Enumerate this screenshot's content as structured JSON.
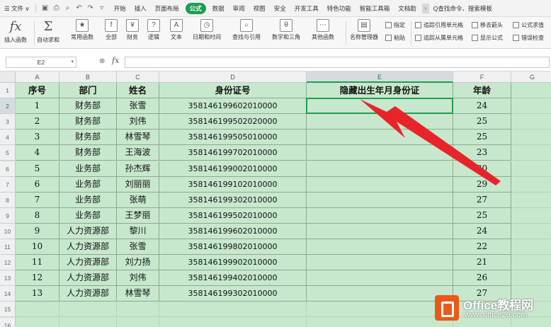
{
  "menubar": {
    "file_label": "☰ 文件 ∨",
    "tabs": [
      "开始",
      "插入",
      "页面布局",
      "公式",
      "数据",
      "审阅",
      "视图",
      "安全",
      "开发工具",
      "特色功能",
      "智能工具箱",
      "文档助"
    ],
    "active_tab": "公式",
    "search_label": "Q查找命令、搜索模板"
  },
  "ribbon": {
    "insert_function": "插入函数",
    "autosum": "自动求和",
    "common_functions": "常用函数",
    "all": "全部",
    "finance": "财务",
    "logic": "逻辑",
    "text": "文本",
    "datetime": "日期和时间",
    "lookup": "查找与引用",
    "math": "数学和三角",
    "other_functions": "其他函数",
    "name_manager": "名称管理器",
    "specify": "指定",
    "paste": "粘贴",
    "trace_precedents": "追踪引用单元格",
    "trace_dependents": "追踪从属单元格",
    "remove_arrows": "移去箭头",
    "show_formulas": "显示公式",
    "evaluate": "公式求值",
    "error_check": "错误检查"
  },
  "formula_bar": {
    "cell_ref": "E2",
    "fx_label": "fx",
    "formula": ""
  },
  "sheet": {
    "columns": [
      "A",
      "B",
      "C",
      "D",
      "E",
      "F",
      "G"
    ],
    "selected_column": "E",
    "row_numbers": [
      "1",
      "2",
      "3",
      "4",
      "5",
      "6",
      "7",
      "8",
      "9",
      "10",
      "11",
      "12",
      "13",
      "14",
      "15",
      "16"
    ],
    "selected_row": "2",
    "headers": [
      "序号",
      "部门",
      "姓名",
      "身份证号",
      "隐藏出生年月身份证",
      "年龄"
    ],
    "rows": [
      [
        "1",
        "财务部",
        "张雪",
        "358146199602010000",
        "",
        "24"
      ],
      [
        "2",
        "财务部",
        "刘伟",
        "358146199502020000",
        "",
        "25"
      ],
      [
        "3",
        "财务部",
        "林雪琴",
        "358146199505010000",
        "",
        "25"
      ],
      [
        "4",
        "财务部",
        "王海波",
        "358146199702010000",
        "",
        "23"
      ],
      [
        "5",
        "业务部",
        "孙杰辉",
        "358146199002010000",
        "",
        "30"
      ],
      [
        "6",
        "业务部",
        "刘丽丽",
        "358146199102010000",
        "",
        "29"
      ],
      [
        "7",
        "业务部",
        "张萌",
        "358146199302010000",
        "",
        "27"
      ],
      [
        "8",
        "业务部",
        "王梦丽",
        "358146199502010000",
        "",
        "25"
      ],
      [
        "9",
        "人力资源部",
        "黎川",
        "358146199602010000",
        "",
        "24"
      ],
      [
        "10",
        "人力资源部",
        "张雪",
        "358146199802010000",
        "",
        "22"
      ],
      [
        "11",
        "人力资源部",
        "刘力扬",
        "358146199902010000",
        "",
        "21"
      ],
      [
        "12",
        "人力资源部",
        "刘伟",
        "358146199402010000",
        "",
        "26"
      ],
      [
        "13",
        "人力资源部",
        "林雪琴",
        "358146199302010000",
        "",
        "27"
      ]
    ]
  },
  "watermark": {
    "title": "Office教程网",
    "url": "www.office26.com"
  },
  "colors": {
    "sheet_fill": "#c7e8cd",
    "accent_green": "#1e9f4f",
    "arrow_red": "#e8242b"
  }
}
